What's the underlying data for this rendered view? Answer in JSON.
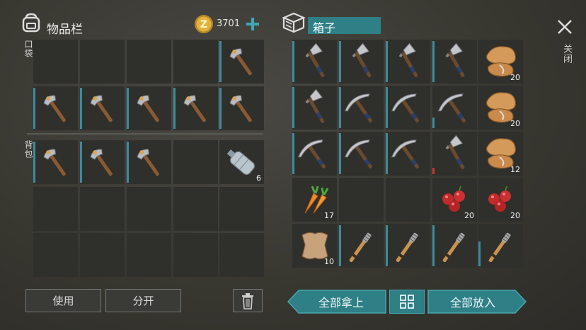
{
  "inventory": {
    "title": "物品栏",
    "coins": "3701",
    "pocket_label": "口袋",
    "backpack_label": "背包",
    "use_label": "使用",
    "split_label": "分开"
  },
  "box": {
    "title": "箱子",
    "close_label": "关闭",
    "take_all_label": "全部拿上",
    "put_all_label": "全部放入"
  },
  "left_slots": [
    {
      "item": "",
      "count": ""
    },
    {
      "item": "",
      "count": ""
    },
    {
      "item": "",
      "count": ""
    },
    {
      "item": "",
      "count": ""
    },
    {
      "item": "hatchet-icon",
      "count": "",
      "durability": 1.0
    },
    {
      "item": "hatchet-icon",
      "count": "",
      "durability": 1.0
    },
    {
      "item": "hatchet-icon",
      "count": "",
      "durability": 1.0
    },
    {
      "item": "hatchet-icon",
      "count": "",
      "durability": 1.0
    },
    {
      "item": "hatchet-icon",
      "count": "",
      "durability": 1.0
    },
    {
      "item": "hatchet-icon",
      "count": "",
      "durability": 1.0
    },
    {
      "item": "hatchet-icon",
      "count": "",
      "durability": 1.0
    },
    {
      "item": "hatchet-icon",
      "count": "",
      "durability": 1.0
    },
    {
      "item": "hatchet-icon",
      "count": "",
      "durability": 1.0
    },
    {
      "item": "",
      "count": ""
    },
    {
      "item": "water-bottle-icon",
      "count": "6"
    },
    {
      "item": "",
      "count": ""
    },
    {
      "item": "",
      "count": ""
    },
    {
      "item": "",
      "count": ""
    },
    {
      "item": "",
      "count": ""
    },
    {
      "item": "",
      "count": ""
    },
    {
      "item": "",
      "count": ""
    },
    {
      "item": "",
      "count": ""
    },
    {
      "item": "",
      "count": ""
    },
    {
      "item": "",
      "count": ""
    },
    {
      "item": "",
      "count": ""
    }
  ],
  "right_slots": [
    {
      "item": "axe-icon",
      "count": "",
      "durability": 1.0
    },
    {
      "item": "axe-icon",
      "count": "",
      "durability": 1.0
    },
    {
      "item": "axe-icon",
      "count": "",
      "durability": 1.0
    },
    {
      "item": "axe-icon",
      "count": "",
      "durability": 1.0
    },
    {
      "item": "leather-scraps-icon",
      "count": "20"
    },
    {
      "item": "axe-icon",
      "count": "",
      "durability": 1.0
    },
    {
      "item": "pickaxe-icon",
      "count": "",
      "durability": 1.0
    },
    {
      "item": "pickaxe-icon",
      "count": "",
      "durability": 1.0
    },
    {
      "item": "pickaxe-icon",
      "count": "",
      "durability": 0.25
    },
    {
      "item": "leather-scraps-icon",
      "count": "20"
    },
    {
      "item": "pickaxe-icon",
      "count": "",
      "durability": 1.0
    },
    {
      "item": "pickaxe-icon",
      "count": "",
      "durability": 1.0
    },
    {
      "item": "pickaxe-icon",
      "count": "",
      "durability": 1.0
    },
    {
      "item": "axe-icon",
      "count": "",
      "durability": 0.15,
      "dur_color": "#c8352b"
    },
    {
      "item": "leather-scraps-icon",
      "count": "12"
    },
    {
      "item": "carrot-icon",
      "count": "17"
    },
    {
      "item": "",
      "count": ""
    },
    {
      "item": "",
      "count": ""
    },
    {
      "item": "berries-icon",
      "count": "20"
    },
    {
      "item": "berries-icon",
      "count": "20"
    },
    {
      "item": "hide-icon",
      "count": "10"
    },
    {
      "item": "torch-club-icon",
      "count": "",
      "durability": 1.0
    },
    {
      "item": "torch-club-icon",
      "count": "",
      "durability": 1.0
    },
    {
      "item": "torch-club-icon",
      "count": "",
      "durability": 1.0
    },
    {
      "item": "torch-club-icon",
      "count": "",
      "durability": 0.6
    }
  ],
  "colors": {
    "accent": "#3c8c9e",
    "teal_button": "#2f7f86",
    "coin": "#e3b23c"
  }
}
